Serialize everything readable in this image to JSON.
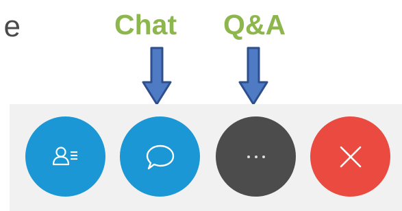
{
  "intro": {
    "partial_text": "e"
  },
  "callouts": {
    "chat_label": "Chat",
    "qa_label": "Q&A",
    "arrow_color": "#4f7ac4",
    "label_color": "#8db64c"
  },
  "toolbar": {
    "background": "#f1f1f1",
    "buttons": [
      {
        "icon": "participants-icon",
        "color": "#1a97d4"
      },
      {
        "icon": "chat-bubble-icon",
        "color": "#1a97d4"
      },
      {
        "icon": "more-options-icon",
        "color": "#4c4c4c"
      },
      {
        "icon": "close-icon",
        "color": "#ea4a40"
      }
    ]
  }
}
